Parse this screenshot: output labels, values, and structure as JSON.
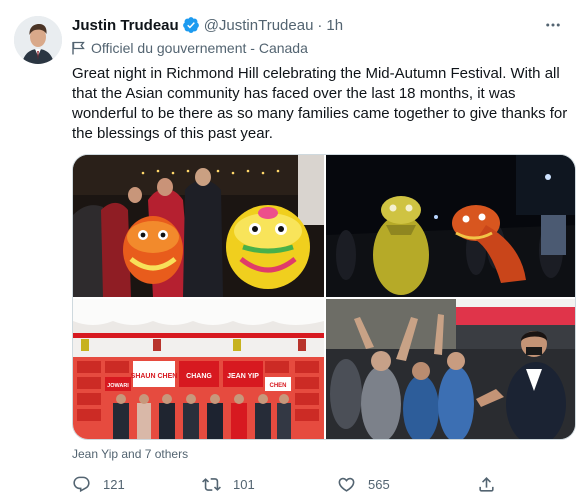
{
  "tweet": {
    "author_name": "Justin Trudeau",
    "handle": "@JustinTrudeau",
    "separator": "·",
    "time": "1h",
    "gov_label": "Officiel du gouvernement - Canada",
    "text": "Great night in Richmond Hill celebrating the Mid-Autumn Festival. With all that the Asian community has faced over the last 18 months, it was wonderful to be there as so many families came together to give thanks for the blessings of this past year.",
    "tagged": "Jean Yip and 7 others",
    "stats": {
      "replies": "121",
      "retweets": "101",
      "likes": "565"
    },
    "photo_signs": {
      "sign_1": "SHAUN CHEN",
      "sign_2": "CHANG",
      "sign_3": "JEAN YIP",
      "sign_4": "JOWARI",
      "sign_5": "CHEN"
    }
  },
  "colors": {
    "text_primary": "#0f1419",
    "text_secondary": "#536471",
    "verified_blue": "#1d9bf0",
    "border": "#cfd9de",
    "liberal_red": "#d71920"
  }
}
